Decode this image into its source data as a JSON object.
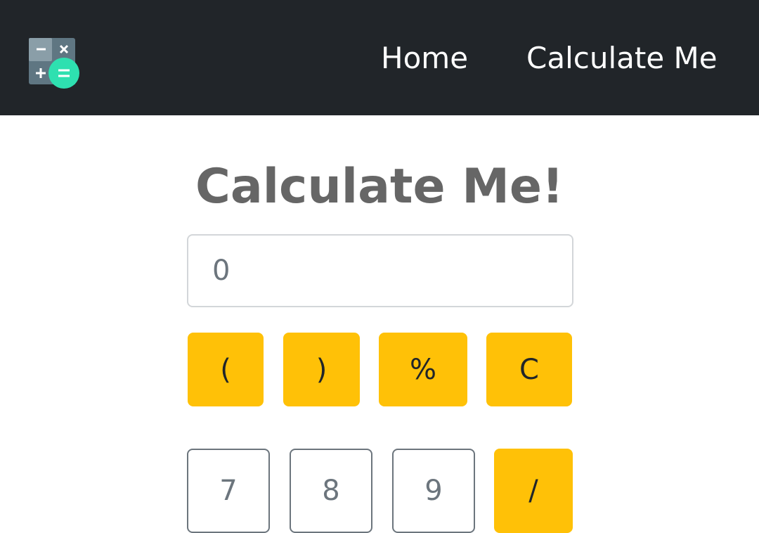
{
  "nav": {
    "logo_icon": "calculator-icon",
    "links": [
      "Home",
      "Calculate Me"
    ]
  },
  "main": {
    "title": "Calculate Me!",
    "display": {
      "value": "",
      "placeholder": "0"
    },
    "keys_row1": [
      "(",
      ")",
      "%",
      "C"
    ],
    "keys_row2": [
      "7",
      "8",
      "9",
      "/"
    ]
  },
  "colors": {
    "navbar": "#212529",
    "warning": "#ffc107",
    "outline": "#6c757d",
    "title": "#666666",
    "logo_equals": "#2ee0b0"
  }
}
